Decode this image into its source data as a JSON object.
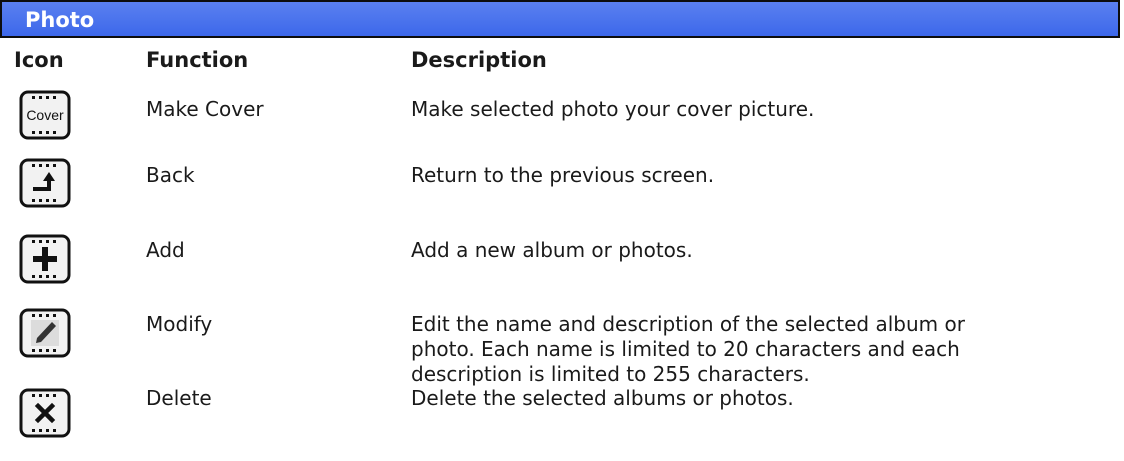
{
  "section": {
    "title": "Photo"
  },
  "columns": {
    "icon": "Icon",
    "function": "Function",
    "description": "Description"
  },
  "rows": [
    {
      "icon": "cover-icon",
      "icon_text": "Cover",
      "function": "Make Cover",
      "description_lines": [
        "Make selected photo your cover picture."
      ]
    },
    {
      "icon": "back-icon",
      "function": "Back",
      "description_lines": [
        "Return to the previous screen."
      ]
    },
    {
      "icon": "add-icon",
      "function": "Add",
      "description_lines": [
        "Add a new album or photos."
      ]
    },
    {
      "icon": "modify-icon",
      "function": "Modify",
      "description_lines": [
        "Edit the name and description of the selected album or",
        "photo. Each name is limited to 20 characters and each",
        "description is limited to 255 characters."
      ]
    },
    {
      "icon": "delete-icon",
      "function": "Delete",
      "description_lines": [
        "Delete the selected albums or photos."
      ]
    }
  ],
  "colors": {
    "header_bar": "#4a73ec",
    "border": "#0d0d0d"
  }
}
